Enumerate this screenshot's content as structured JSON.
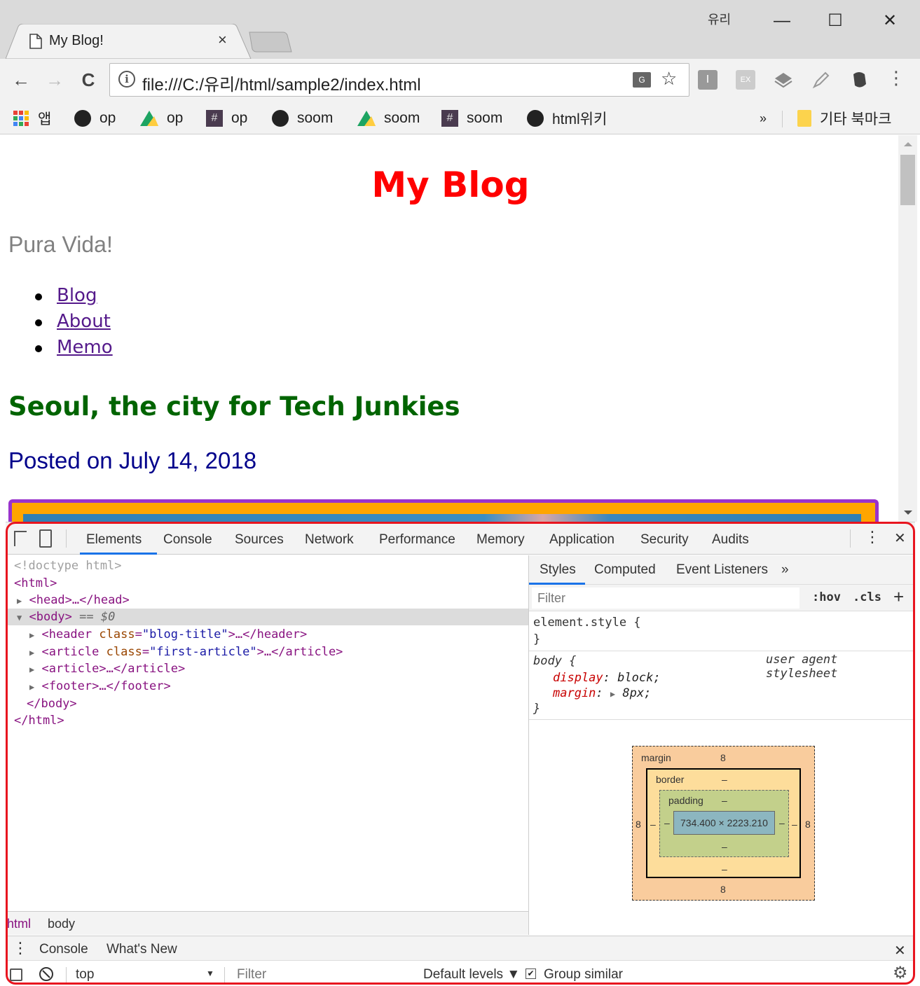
{
  "window": {
    "user_badge": "유리",
    "minimize_glyph": "—",
    "maximize_glyph": "☐",
    "close_glyph": "✕"
  },
  "tab": {
    "title": "My Blog!",
    "close_glyph": "×"
  },
  "toolbar": {
    "back_glyph": "←",
    "forward_glyph": "→",
    "reload_glyph": "C",
    "url": "file:///C:/유리/html/sample2/index.html",
    "info_glyph": "i",
    "translate_glyph": "G",
    "star_glyph": "☆",
    "ext_i": "I",
    "ext_ex": "EX",
    "menu_glyph": "⋮"
  },
  "bookmarks": {
    "items": [
      {
        "label": "앱",
        "icon": "apps-grid-icon"
      },
      {
        "label": "op",
        "icon": "github-icon"
      },
      {
        "label": "op",
        "icon": "google-drive-icon"
      },
      {
        "label": "op",
        "icon": "hash-icon"
      },
      {
        "label": "soom",
        "icon": "github-icon"
      },
      {
        "label": "soom",
        "icon": "google-drive-icon"
      },
      {
        "label": "soom",
        "icon": "hash-icon"
      },
      {
        "label": "html위키",
        "icon": "github-icon"
      }
    ],
    "overflow_glyph": "»",
    "other_label": "기타 북마크",
    "hash_glyph": "#"
  },
  "page": {
    "title": "My Blog",
    "subtitle": "Pura Vida!",
    "nav": [
      "Blog",
      "About",
      "Memo"
    ],
    "article_title": "Seoul, the city for Tech Junkies",
    "posted": "Posted on July 14, 2018"
  },
  "devtools": {
    "tabs": [
      "Elements",
      "Console",
      "Sources",
      "Network",
      "Performance",
      "Memory",
      "Application",
      "Security",
      "Audits"
    ],
    "active_tab": "Elements",
    "kebab_glyph": "⋮",
    "close_glyph": "✕",
    "dom": {
      "doctype": "<!doctype html>",
      "html_open": "<html>",
      "head": "<head>…</head>",
      "body_open": "<body>",
      "body_selected_marker": "== $0",
      "header_tag": "<header",
      "header_attr": "class",
      "header_val": "\"blog-title\"",
      "header_close": ">…</header>",
      "article1_tag": "<article",
      "article1_attr": "class",
      "article1_val": "\"first-article\"",
      "article1_close": ">…</article>",
      "article2": "<article>…</article>",
      "footer": "<footer>…</footer>",
      "body_close": "</body>",
      "html_close": "</html>",
      "eq": "="
    },
    "breadcrumb": [
      "html",
      "body"
    ],
    "styles": {
      "tabs": [
        "Styles",
        "Computed",
        "Event Listeners"
      ],
      "more_glyph": "»",
      "filter_placeholder": "Filter",
      "hov": ":hov",
      "cls": ".cls",
      "plus": "+",
      "element_style_open": "element.style {",
      "element_style_close": "}",
      "body_rule_open": "body {",
      "body_rule_source": "user agent stylesheet",
      "prop1_name": "display",
      "prop1_value": "block;",
      "prop2_name": "margin",
      "prop2_value": "8px;",
      "rule_close": "}",
      "colon": ":"
    },
    "box_model": {
      "margin_label": "margin",
      "margin_top": "8",
      "margin_bottom": "8",
      "margin_left": "8",
      "margin_right": "8",
      "border_label": "border",
      "border_top": "–",
      "border_bottom": "–",
      "border_left": "–",
      "border_right": "–",
      "padding_label": "padding",
      "padding_top": "–",
      "padding_bottom": "–",
      "padding_left": "–",
      "padding_right": "–",
      "content": "734.400 × 2223.210"
    },
    "drawer": {
      "tabs": [
        "Console",
        "What's New"
      ],
      "context": "top",
      "filter_placeholder": "Filter",
      "levels": "Default levels ▼",
      "group_similar": "Group similar",
      "close_glyph": "✕",
      "kebab_glyph": "⋮",
      "gear_glyph": "⚙",
      "dropdown_glyph": "▼",
      "clear_glyph": "⃠"
    }
  },
  "colors": {
    "title_red": "#ff0000",
    "subtitle_gray": "#808080",
    "article_green": "#006400",
    "posted_navy": "#00008b",
    "link_purple": "#551a8b",
    "highlight_frame": "#e8151f",
    "hero_border": "#9933cc",
    "hero_bg": "#ffa500"
  }
}
